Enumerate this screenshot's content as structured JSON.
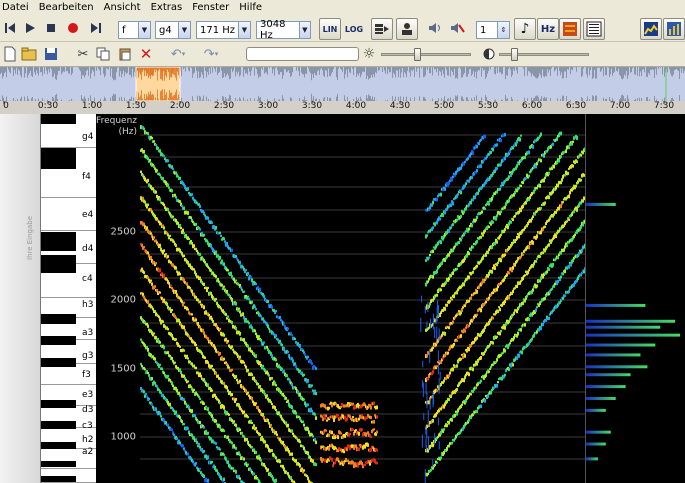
{
  "menu": [
    "Datei",
    "Bearbeiten",
    "Ansicht",
    "Extras",
    "Fenster",
    "Hilfe"
  ],
  "toolbar": {
    "key": "f",
    "note": "g4",
    "freq_low": "171 Hz",
    "freq_high": "3048 Hz",
    "scale_lin": "LIN",
    "scale_log": "LOG",
    "speed": "1",
    "hz_label": "Hz"
  },
  "timeline": {
    "ticks": [
      "0",
      "0:30",
      "1:00",
      "1:30",
      "2:00",
      "2:30",
      "3:00",
      "3:30",
      "4:00",
      "4:30",
      "5:00",
      "5:30",
      "6:00",
      "6:30",
      "7:00",
      "7:30"
    ],
    "tick_seconds": [
      0,
      30,
      60,
      90,
      120,
      150,
      180,
      210,
      240,
      270,
      300,
      330,
      360,
      390,
      420,
      450
    ],
    "selection_start_s": 90,
    "selection_end_s": 120,
    "total_s": 460
  },
  "piano": {
    "notes": [
      "g4",
      "f4",
      "e4",
      "d4",
      "c4",
      "h3",
      "a3",
      "g3",
      "f3",
      "e3",
      "d3",
      "c3",
      "h2",
      "a2"
    ]
  },
  "axis": {
    "label_line1": "Frequenz",
    "label_line2": "(Hz)",
    "ticks": [
      "2500",
      "2000",
      "1500",
      "1000"
    ]
  },
  "piano_side_text": "Ihre Eingabe"
}
